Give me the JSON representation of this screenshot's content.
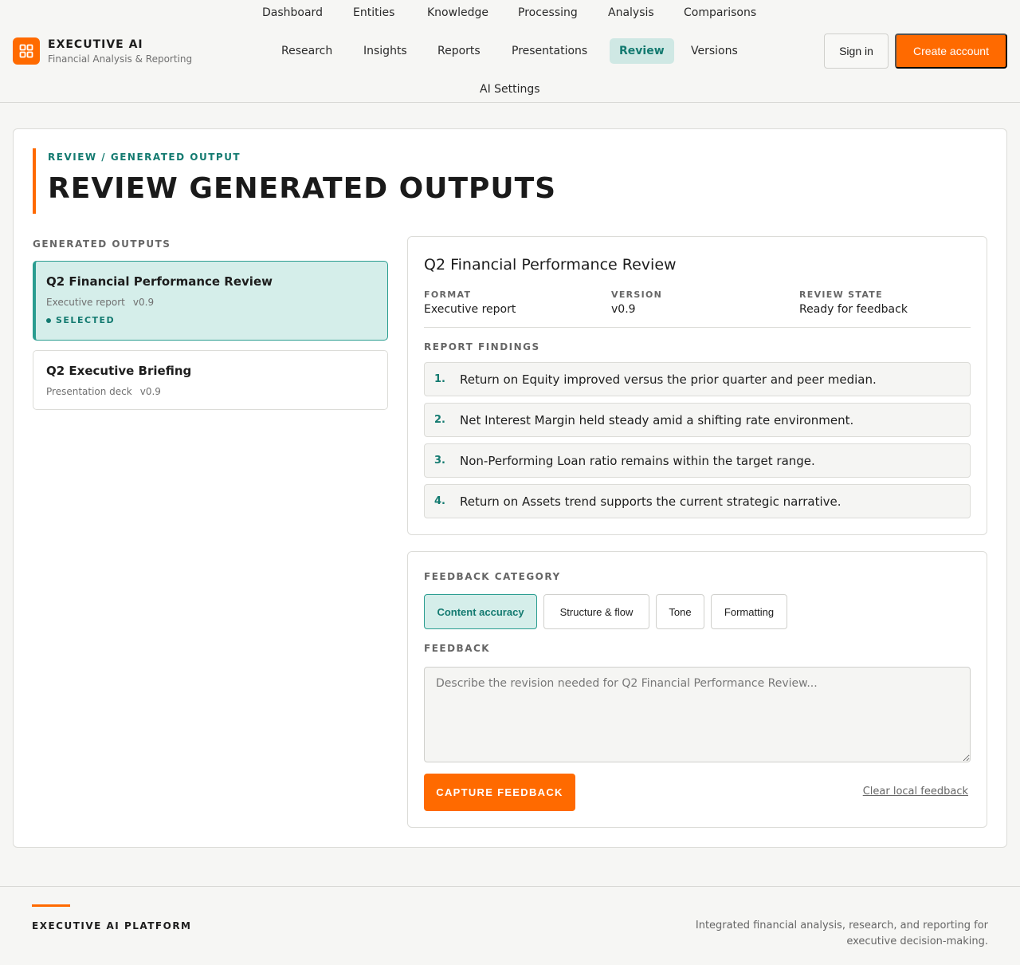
{
  "brand": {
    "name": "EXECUTIVE AI",
    "subtitle": "Financial Analysis & Reporting"
  },
  "nav": {
    "row1": [
      "Dashboard",
      "Entities",
      "Knowledge",
      "Processing",
      "Analysis",
      "Comparisons"
    ],
    "row2": [
      "Research",
      "Insights",
      "Reports",
      "Presentations",
      "Review",
      "Versions"
    ],
    "row3": [
      "AI Settings"
    ],
    "active": "Review"
  },
  "auth": {
    "sign_in": "Sign in",
    "create_account": "Create account"
  },
  "page": {
    "breadcrumb": "REVIEW / GENERATED OUTPUT",
    "title": "REVIEW GENERATED OUTPUTS"
  },
  "outputs": {
    "label": "GENERATED OUTPUTS",
    "selected_label": "SELECTED",
    "items": [
      {
        "title": "Q2 Financial Performance Review",
        "format": "Executive report",
        "version": "v0.9"
      },
      {
        "title": "Q2 Executive Briefing",
        "format": "Presentation deck",
        "version": "v0.9"
      }
    ]
  },
  "detail": {
    "title": "Q2 Financial Performance Review",
    "format_label": "FORMAT",
    "format": "Executive report",
    "version_label": "VERSION",
    "version": "v0.9",
    "state_label": "REVIEW STATE",
    "state": "Ready for feedback",
    "findings_label": "REPORT FINDINGS",
    "findings": [
      {
        "num": "1.",
        "text": "Return on Equity improved versus the prior quarter and peer median."
      },
      {
        "num": "2.",
        "text": "Net Interest Margin held steady amid a shifting rate environment."
      },
      {
        "num": "3.",
        "text": "Non-Performing Loan ratio remains within the target range."
      },
      {
        "num": "4.",
        "text": "Return on Assets trend supports the current strategic narrative."
      }
    ]
  },
  "feedback": {
    "category_label": "FEEDBACK CATEGORY",
    "categories": [
      "Content accuracy",
      "Structure & flow",
      "Tone",
      "Formatting"
    ],
    "active_category": "Content accuracy",
    "feedback_label": "FEEDBACK",
    "placeholder": "Describe the revision needed for Q2 Financial Performance Review...",
    "value": "",
    "capture_button": "CAPTURE FEEDBACK",
    "clear_link": "Clear local feedback"
  },
  "footer": {
    "brand": "EXECUTIVE AI PLATFORM",
    "description": "Integrated financial analysis, research, and reporting for executive decision-making."
  },
  "colors": {
    "accent": "#ff6a00",
    "teal": "#137a70",
    "teal_bg": "#d5eeea",
    "background": "#f6f6f4"
  }
}
